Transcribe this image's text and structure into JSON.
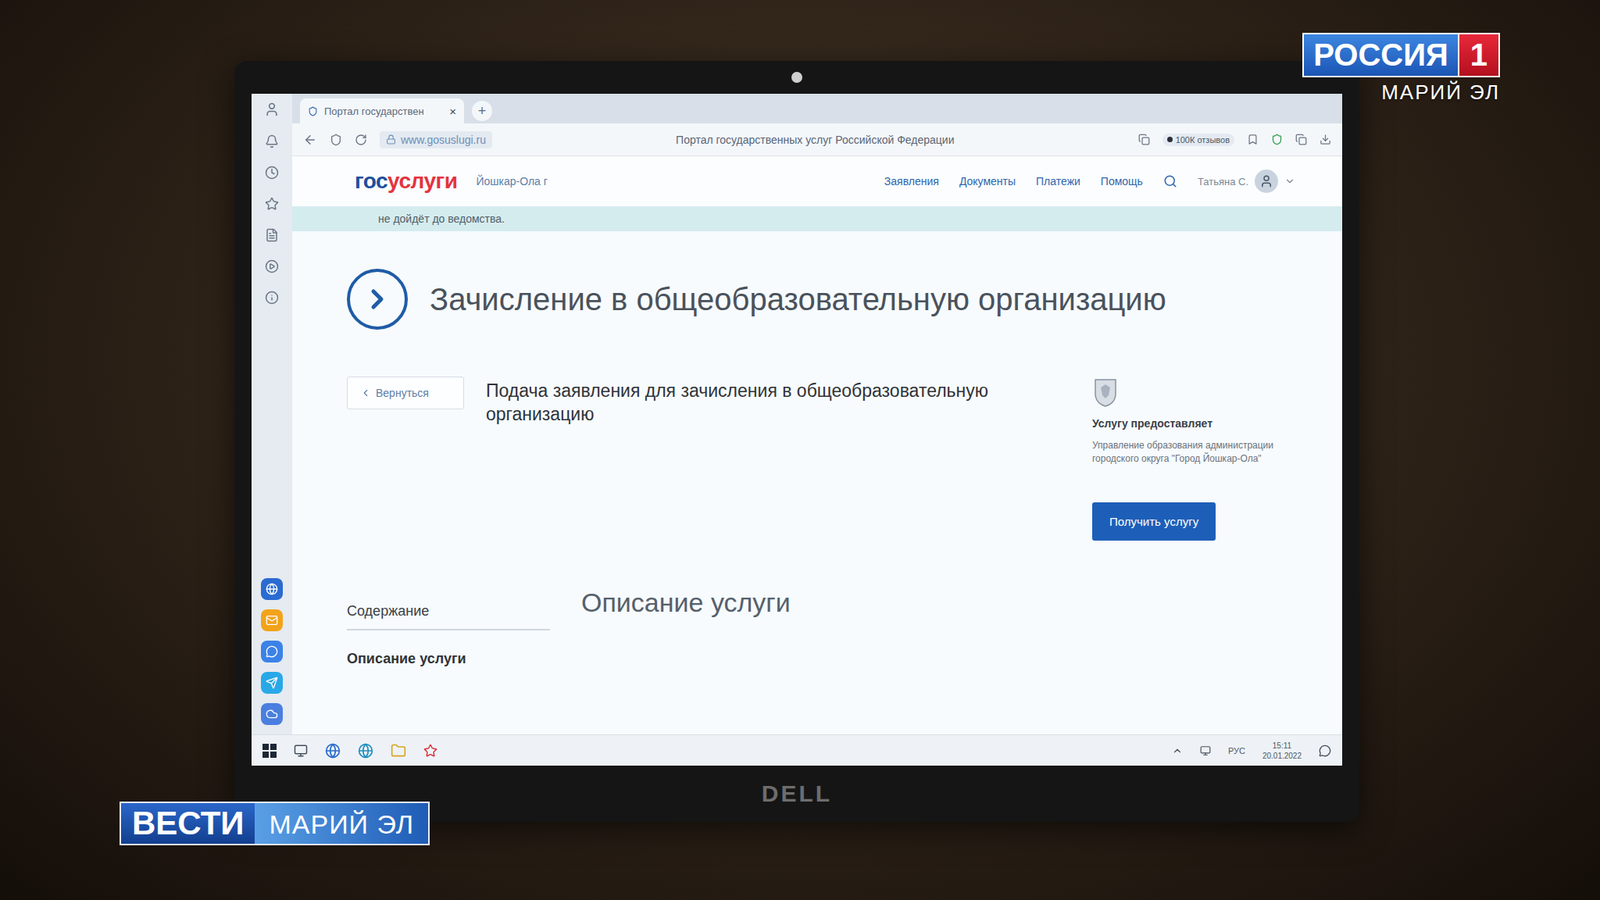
{
  "broadcast": {
    "channel": "РОССИЯ",
    "channel_number": "1",
    "region": "МАРИЙ ЭЛ",
    "program": "ВЕСТИ",
    "program_region": "МАРИЙ ЭЛ"
  },
  "laptop": {
    "brand": "DELL"
  },
  "browser": {
    "tabs": [
      {
        "label": "Портал государствен",
        "close": "×",
        "selected": true
      }
    ],
    "new_tab": "+",
    "address": "www.gosuslugi.ru",
    "page_title": "Портал государственных услуг Российской Федерации",
    "reviews": "100К отзывов"
  },
  "site": {
    "logo_prefix": "гос",
    "logo_suffix": "услуги",
    "city": "Йошкар-Ола г",
    "nav": [
      "Заявления",
      "Документы",
      "Платежи",
      "Помощь"
    ],
    "user": "Татьяна С.",
    "notice": "не дойдёт до ведомства."
  },
  "service": {
    "title": "Зачисление в общеобразовательную организацию",
    "back": "Вернуться",
    "subtitle": "Подача заявления для зачисления в общеобразовательную организацию",
    "provider_label": "Услугу предоставляет",
    "provider": "Управление образования администрации городского округа \"Город Йошкар-Ола\"",
    "action": "Получить услугу",
    "description_heading": "Описание услуги",
    "toc": {
      "title": "Содержание",
      "items": [
        {
          "label": "Описание услуги",
          "selected": true
        }
      ]
    }
  },
  "taskbar": {
    "lang": "РУС",
    "time": "15:11",
    "date": "20.01.2022"
  }
}
